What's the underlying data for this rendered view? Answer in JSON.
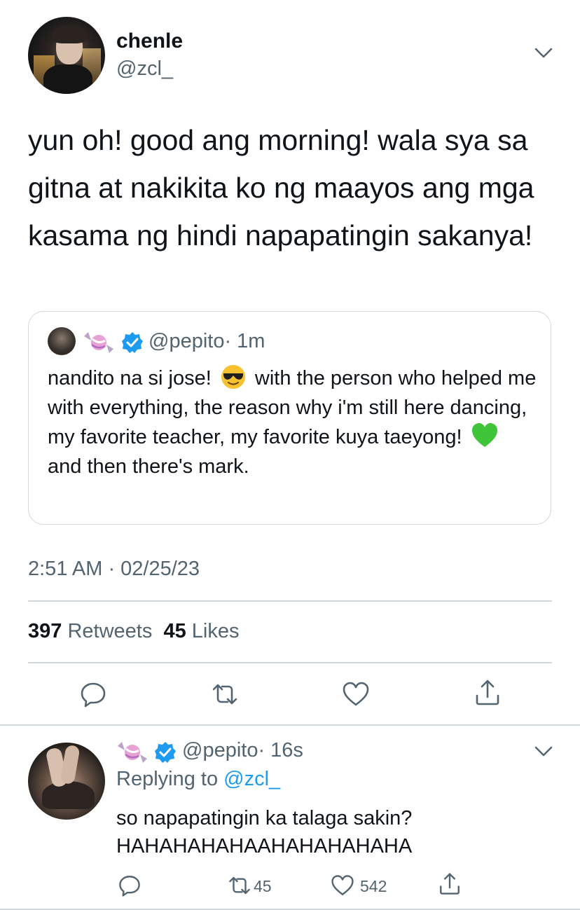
{
  "tweet": {
    "author_name": "chenle",
    "author_handle": "@zcl_",
    "text": "yun oh! good ang morning! wala sya sa gitna at nakikita ko ng maayos ang mga kasama ng hindi napapatingin sakanya!",
    "timestamp": "2:51 AM · 02/25/23",
    "retweets_count": "397",
    "retweets_label": "Retweets",
    "likes_count": "45",
    "likes_label": "Likes"
  },
  "quote": {
    "handle": "@pepito",
    "time": "· 1m",
    "text_part1": "nandito na si jose!",
    "text_part2": "with the person who helped me with everything, the reason why i'm still here dancing, my favorite teacher, my favorite kuya taeyong!",
    "text_part3": "and then there's mark."
  },
  "reply": {
    "handle": "@pepito",
    "time": "· 16s",
    "replying_prefix": "Replying to",
    "replying_to": "@zcl_",
    "text": "so napapatingin ka talaga sakin? HAHAHAHAHAAHAHAHAHAHA",
    "retweets_count": "45",
    "likes_count": "542"
  },
  "icons": [
    "chevron-down-icon",
    "candy-emoji-icon",
    "verified-badge-icon",
    "sunglasses-emoji-icon",
    "green-heart-emoji-icon",
    "reply-icon",
    "retweet-icon",
    "like-icon",
    "share-icon"
  ],
  "colors": {
    "text": "#0f1419",
    "secondary": "#536471",
    "link": "#1d9bf0",
    "verified": "#1d9bf0",
    "border": "#cfd9de"
  }
}
